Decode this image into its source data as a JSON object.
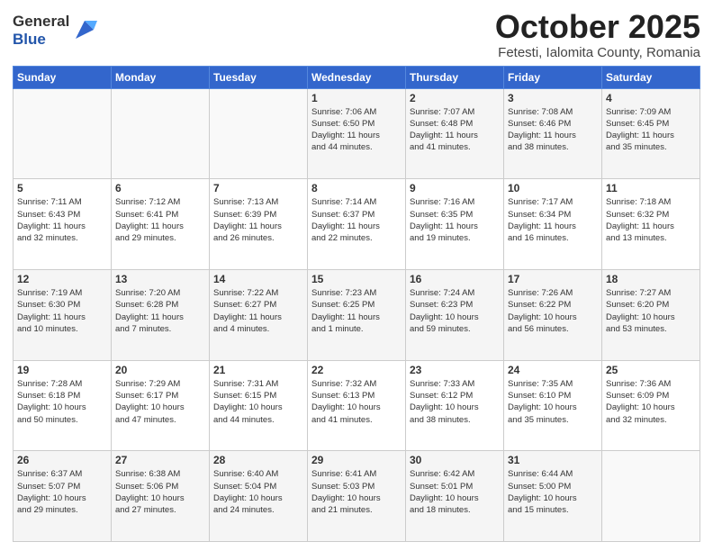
{
  "header": {
    "title": "October 2025",
    "location": "Fetesti, Ialomita County, Romania"
  },
  "days": [
    "Sunday",
    "Monday",
    "Tuesday",
    "Wednesday",
    "Thursday",
    "Friday",
    "Saturday"
  ],
  "weeks": [
    [
      {
        "day": "",
        "info": ""
      },
      {
        "day": "",
        "info": ""
      },
      {
        "day": "",
        "info": ""
      },
      {
        "day": "1",
        "info": "Sunrise: 7:06 AM\nSunset: 6:50 PM\nDaylight: 11 hours\nand 44 minutes."
      },
      {
        "day": "2",
        "info": "Sunrise: 7:07 AM\nSunset: 6:48 PM\nDaylight: 11 hours\nand 41 minutes."
      },
      {
        "day": "3",
        "info": "Sunrise: 7:08 AM\nSunset: 6:46 PM\nDaylight: 11 hours\nand 38 minutes."
      },
      {
        "day": "4",
        "info": "Sunrise: 7:09 AM\nSunset: 6:45 PM\nDaylight: 11 hours\nand 35 minutes."
      }
    ],
    [
      {
        "day": "5",
        "info": "Sunrise: 7:11 AM\nSunset: 6:43 PM\nDaylight: 11 hours\nand 32 minutes."
      },
      {
        "day": "6",
        "info": "Sunrise: 7:12 AM\nSunset: 6:41 PM\nDaylight: 11 hours\nand 29 minutes."
      },
      {
        "day": "7",
        "info": "Sunrise: 7:13 AM\nSunset: 6:39 PM\nDaylight: 11 hours\nand 26 minutes."
      },
      {
        "day": "8",
        "info": "Sunrise: 7:14 AM\nSunset: 6:37 PM\nDaylight: 11 hours\nand 22 minutes."
      },
      {
        "day": "9",
        "info": "Sunrise: 7:16 AM\nSunset: 6:35 PM\nDaylight: 11 hours\nand 19 minutes."
      },
      {
        "day": "10",
        "info": "Sunrise: 7:17 AM\nSunset: 6:34 PM\nDaylight: 11 hours\nand 16 minutes."
      },
      {
        "day": "11",
        "info": "Sunrise: 7:18 AM\nSunset: 6:32 PM\nDaylight: 11 hours\nand 13 minutes."
      }
    ],
    [
      {
        "day": "12",
        "info": "Sunrise: 7:19 AM\nSunset: 6:30 PM\nDaylight: 11 hours\nand 10 minutes."
      },
      {
        "day": "13",
        "info": "Sunrise: 7:20 AM\nSunset: 6:28 PM\nDaylight: 11 hours\nand 7 minutes."
      },
      {
        "day": "14",
        "info": "Sunrise: 7:22 AM\nSunset: 6:27 PM\nDaylight: 11 hours\nand 4 minutes."
      },
      {
        "day": "15",
        "info": "Sunrise: 7:23 AM\nSunset: 6:25 PM\nDaylight: 11 hours\nand 1 minute."
      },
      {
        "day": "16",
        "info": "Sunrise: 7:24 AM\nSunset: 6:23 PM\nDaylight: 10 hours\nand 59 minutes."
      },
      {
        "day": "17",
        "info": "Sunrise: 7:26 AM\nSunset: 6:22 PM\nDaylight: 10 hours\nand 56 minutes."
      },
      {
        "day": "18",
        "info": "Sunrise: 7:27 AM\nSunset: 6:20 PM\nDaylight: 10 hours\nand 53 minutes."
      }
    ],
    [
      {
        "day": "19",
        "info": "Sunrise: 7:28 AM\nSunset: 6:18 PM\nDaylight: 10 hours\nand 50 minutes."
      },
      {
        "day": "20",
        "info": "Sunrise: 7:29 AM\nSunset: 6:17 PM\nDaylight: 10 hours\nand 47 minutes."
      },
      {
        "day": "21",
        "info": "Sunrise: 7:31 AM\nSunset: 6:15 PM\nDaylight: 10 hours\nand 44 minutes."
      },
      {
        "day": "22",
        "info": "Sunrise: 7:32 AM\nSunset: 6:13 PM\nDaylight: 10 hours\nand 41 minutes."
      },
      {
        "day": "23",
        "info": "Sunrise: 7:33 AM\nSunset: 6:12 PM\nDaylight: 10 hours\nand 38 minutes."
      },
      {
        "day": "24",
        "info": "Sunrise: 7:35 AM\nSunset: 6:10 PM\nDaylight: 10 hours\nand 35 minutes."
      },
      {
        "day": "25",
        "info": "Sunrise: 7:36 AM\nSunset: 6:09 PM\nDaylight: 10 hours\nand 32 minutes."
      }
    ],
    [
      {
        "day": "26",
        "info": "Sunrise: 6:37 AM\nSunset: 5:07 PM\nDaylight: 10 hours\nand 29 minutes."
      },
      {
        "day": "27",
        "info": "Sunrise: 6:38 AM\nSunset: 5:06 PM\nDaylight: 10 hours\nand 27 minutes."
      },
      {
        "day": "28",
        "info": "Sunrise: 6:40 AM\nSunset: 5:04 PM\nDaylight: 10 hours\nand 24 minutes."
      },
      {
        "day": "29",
        "info": "Sunrise: 6:41 AM\nSunset: 5:03 PM\nDaylight: 10 hours\nand 21 minutes."
      },
      {
        "day": "30",
        "info": "Sunrise: 6:42 AM\nSunset: 5:01 PM\nDaylight: 10 hours\nand 18 minutes."
      },
      {
        "day": "31",
        "info": "Sunrise: 6:44 AM\nSunset: 5:00 PM\nDaylight: 10 hours\nand 15 minutes."
      },
      {
        "day": "",
        "info": ""
      }
    ]
  ]
}
